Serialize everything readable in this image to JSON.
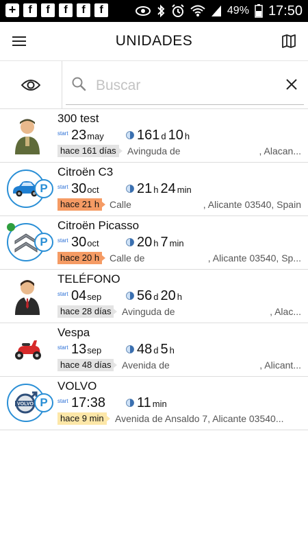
{
  "status_bar": {
    "battery": "49%",
    "time": "17:50"
  },
  "header": {
    "title": "UNIDADES"
  },
  "search": {
    "placeholder": "Buscar",
    "value": ""
  },
  "units": [
    {
      "name": "300 test",
      "avatar": "soldier-avatar",
      "parked": false,
      "start_label": "start",
      "start_value": "23",
      "start_unit": "may",
      "duration": [
        [
          "161",
          "d"
        ],
        [
          "10",
          "h"
        ]
      ],
      "ago": "hace 161 días",
      "ago_color": "gray",
      "address_a": "Avinguda de",
      "address_b": ", Alacan..."
    },
    {
      "name": "Citroën C3",
      "avatar": "blue-car-icon",
      "parked": true,
      "start_label": "start",
      "start_value": "30",
      "start_unit": "oct",
      "duration": [
        [
          "21",
          "h"
        ],
        [
          "24",
          "min"
        ]
      ],
      "ago": "hace 21 h",
      "ago_color": "orange",
      "address_a": "Calle",
      "address_b": ", Alicante 03540, Spain"
    },
    {
      "name": "Citroën Picasso",
      "avatar": "citroen-logo-icon",
      "parked": true,
      "start_label": "start",
      "start_value": "30",
      "start_unit": "oct",
      "duration": [
        [
          "20",
          "h"
        ],
        [
          "7",
          "min"
        ]
      ],
      "ago": "hace 20 h",
      "ago_color": "orange",
      "address_a": "Calle de",
      "address_b": ", Alicante 03540, Sp..."
    },
    {
      "name": "TELÉFONO",
      "avatar": "businessman-avatar",
      "parked": false,
      "start_label": "start",
      "start_value": "04",
      "start_unit": "sep",
      "duration": [
        [
          "56",
          "d"
        ],
        [
          "20",
          "h"
        ]
      ],
      "ago": "hace 28 días",
      "ago_color": "gray",
      "address_a": "Avinguda de",
      "address_b": ", Alac..."
    },
    {
      "name": "Vespa",
      "avatar": "scooter-icon",
      "parked": false,
      "start_label": "start",
      "start_value": "13",
      "start_unit": "sep",
      "duration": [
        [
          "48",
          "d"
        ],
        [
          "5",
          "h"
        ]
      ],
      "ago": "hace 48 días",
      "ago_color": "gray",
      "address_a": "Avenida de",
      "address_b": ", Alicant..."
    },
    {
      "name": "VOLVO",
      "avatar": "volvo-logo-icon",
      "parked": true,
      "start_label": "start",
      "start_value": "17:38",
      "start_unit": "",
      "duration": [
        [
          "11",
          "min"
        ]
      ],
      "ago": "hace 9 min",
      "ago_color": "yellow",
      "address_a": "Avenida de Ansaldo 7, Alicante 03540...",
      "address_b": ""
    }
  ],
  "parking_badge": "P"
}
